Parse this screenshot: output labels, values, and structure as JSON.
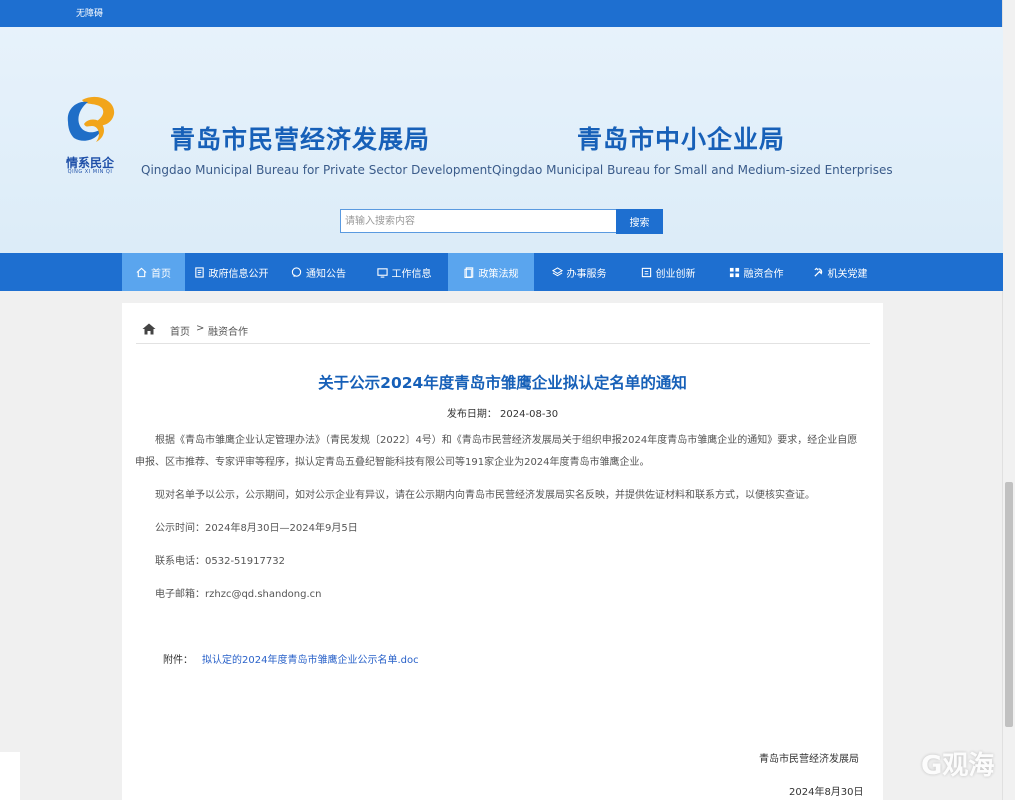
{
  "topbar": {
    "accessibility_label": "无障碍"
  },
  "header": {
    "logo_caption": "情系民企",
    "logo_sub": "QING XI MIN QI",
    "org1_cn": "青岛市民营经济发展局",
    "org1_en": "Qingdao Municipal Bureau for Private Sector Development",
    "org2_cn": "青岛市中小企业局",
    "org2_en": "Qingdao Municipal Bureau for Small and Medium-sized Enterprises"
  },
  "search": {
    "placeholder": "请输入搜索内容",
    "button": "搜索"
  },
  "nav": [
    {
      "label": "首页",
      "icon": "home-icon"
    },
    {
      "label": "政府信息公开",
      "icon": "document-icon"
    },
    {
      "label": "通知公告",
      "icon": "chat-icon"
    },
    {
      "label": "工作信息",
      "icon": "monitor-icon"
    },
    {
      "label": "政策法规",
      "icon": "policy-icon"
    },
    {
      "label": "办事服务",
      "icon": "layers-icon"
    },
    {
      "label": "创业创新",
      "icon": "frame-icon"
    },
    {
      "label": "融资合作",
      "icon": "grid-icon"
    },
    {
      "label": "机关党建",
      "icon": "party-icon"
    }
  ],
  "breadcrumb": {
    "home": "首页",
    "sep": ">",
    "current": "融资合作"
  },
  "article": {
    "title": "关于公示2024年度青岛市雏鹰企业拟认定名单的通知",
    "pub_label": "发布日期：",
    "pub_date": "2024-08-30",
    "p1_line1": "根据《青岛市雏鹰企业认定管理办法》（青民发规〔2022〕4号）和《青岛市民营经济发展局关于组织申报2024年度青岛市雏鹰企业的通知》要求，经企业自愿",
    "p1_line2": "申报、区市推荐、专家评审等程序，拟认定青岛五叠纪智能科技有限公司等191家企业为2024年度青岛市雏鹰企业。",
    "p2": "现对名单予以公示，公示期间，如对公示企业有异议，请在公示期内向青岛市民营经济发展局实名反映，并提供佐证材料和联系方式，以便核实查证。",
    "period": "公示时间：2024年8月30日—2024年9月5日",
    "phone": "联系电话：0532-51917732",
    "email": "电子邮箱：rzhzc@qd.shandong.cn",
    "attach_label": "附件：",
    "attach_file": "拟认定的2024年度青岛市雏鹰企业公示名单.doc",
    "sign_org": "青岛市民营经济发展局",
    "sign_date": "2024年8月30日"
  },
  "watermark": "G观海",
  "colors": {
    "primary": "#1e6fd0",
    "nav_active": "#5aa5ee",
    "title": "#1760b8",
    "link": "#2a62c9",
    "header_bg": "#e3effa"
  }
}
